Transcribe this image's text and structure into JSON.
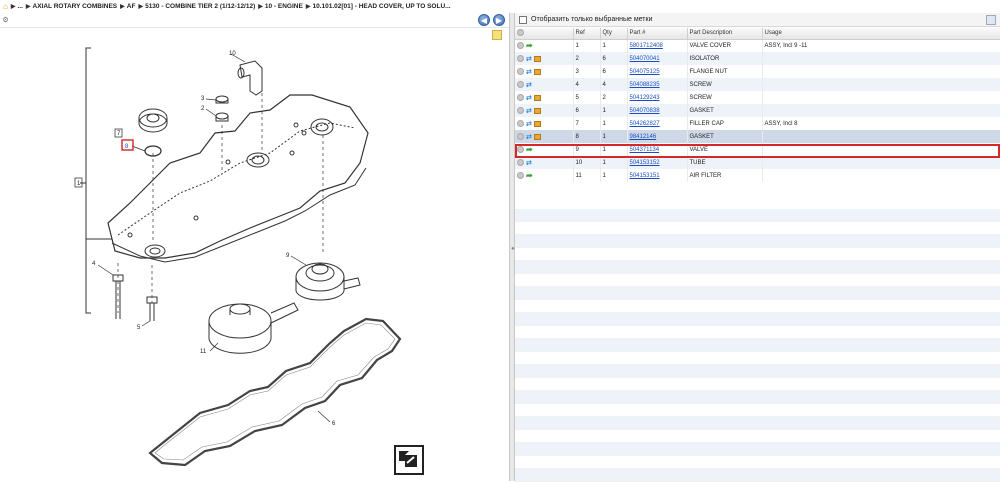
{
  "breadcrumb": {
    "items": [
      "...",
      "AXIAL ROTARY COMBINES",
      "AF",
      "5130 - COMBINE TIER 2 (1/12-12/12)",
      "10 - ENGINE",
      "10.101.02[01] - HEAD COVER, UP TO SOLU..."
    ]
  },
  "filter": {
    "label": "Отобразить только выбранные метки"
  },
  "table": {
    "headers": [
      "",
      "Ref",
      "Qty",
      "Part #",
      "Part Description",
      "Usage"
    ],
    "rows": [
      {
        "ref": "1",
        "qty": "1",
        "part": "5801712408",
        "desc": "VALVE COVER",
        "usage": "ASSY, Incl 9 -11",
        "icons": "arrow"
      },
      {
        "ref": "2",
        "qty": "6",
        "part": "504070041",
        "desc": "ISOLATOR",
        "usage": "",
        "icons": "swap-box"
      },
      {
        "ref": "3",
        "qty": "6",
        "part": "504075125",
        "desc": "FLANGE NUT",
        "usage": "",
        "icons": "swap-box"
      },
      {
        "ref": "4",
        "qty": "4",
        "part": "504088235",
        "desc": "SCREW",
        "usage": "",
        "icons": "swap"
      },
      {
        "ref": "5",
        "qty": "2",
        "part": "504129243",
        "desc": "SCREW",
        "usage": "",
        "icons": "swap-box"
      },
      {
        "ref": "6",
        "qty": "1",
        "part": "504070838",
        "desc": "GASKET",
        "usage": "",
        "icons": "swap-box"
      },
      {
        "ref": "7",
        "qty": "1",
        "part": "504262827",
        "desc": "FILLER CAP",
        "usage": "ASSY, Incl 8",
        "icons": "swap-box"
      },
      {
        "ref": "8",
        "qty": "1",
        "part": "98412146",
        "desc": "GASKET",
        "usage": "",
        "icons": "swap-box"
      },
      {
        "ref": "9",
        "qty": "1",
        "part": "504371134",
        "desc": "VALVE",
        "usage": "",
        "icons": "arrow"
      },
      {
        "ref": "10",
        "qty": "1",
        "part": "504153152",
        "desc": "TUBE",
        "usage": "",
        "icons": "swap"
      },
      {
        "ref": "11",
        "qty": "1",
        "part": "504153151",
        "desc": "AIR FILTER",
        "usage": "",
        "icons": "arrow"
      }
    ],
    "selected_ref": "8"
  },
  "diagram": {
    "callouts": [
      "10",
      "3",
      "2",
      "7",
      "8",
      "1",
      "9",
      "4",
      "5",
      "11",
      "6"
    ]
  },
  "colors": {
    "link": "#1a4fc4",
    "selection_frame": "#d62828",
    "row_alt": "#eef3fa"
  }
}
